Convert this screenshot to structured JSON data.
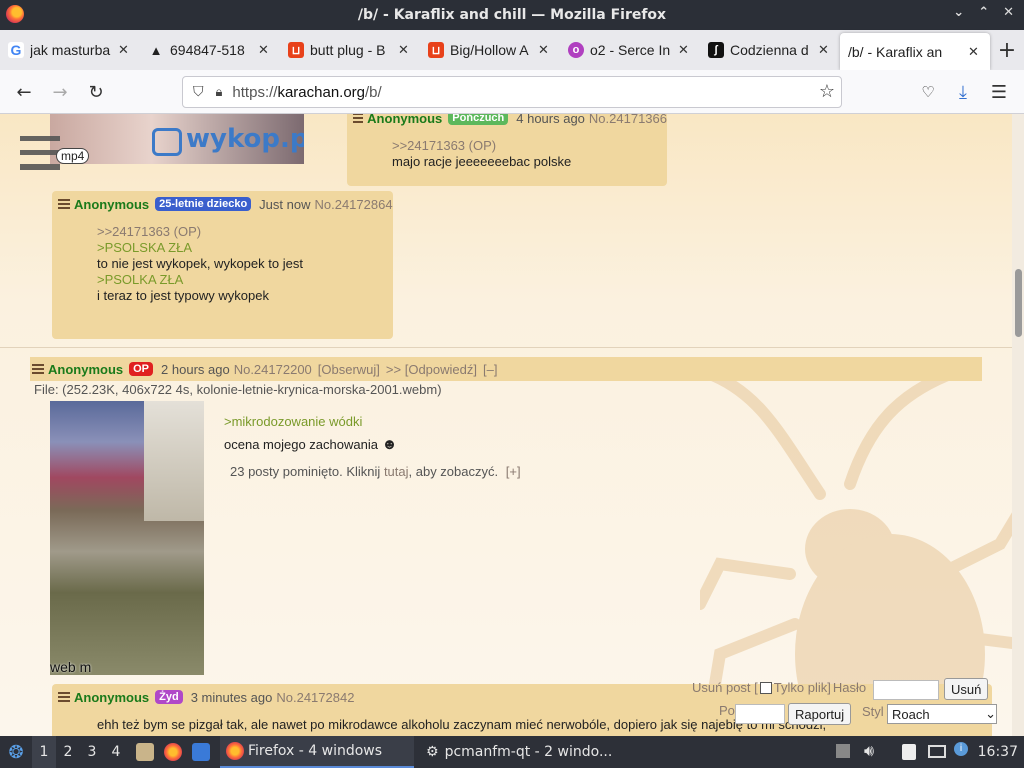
{
  "window": {
    "title": "/b/ - Karaflix and chill — Mozilla Firefox",
    "controls": [
      "⌄",
      "⌃",
      "✕"
    ]
  },
  "tabs": [
    {
      "title": "jak masturba",
      "icon": "google-icon",
      "color": "#4285f4",
      "glyph": "G"
    },
    {
      "title": "694847-518",
      "icon": "warning-icon",
      "color": "#222222",
      "glyph": "▲"
    },
    {
      "title": "butt plug - B",
      "icon": "shop-icon",
      "color": "#e8411a",
      "glyph": "⊔"
    },
    {
      "title": "Big/Hollow A",
      "icon": "shop-icon",
      "color": "#e8411a",
      "glyph": "⊔"
    },
    {
      "title": "o2 - Serce In",
      "icon": "o2-icon",
      "color": "#b040c0",
      "glyph": "o"
    },
    {
      "title": "Codzienna d",
      "icon": "book-icon",
      "color": "#111111",
      "glyph": "ʃ"
    },
    {
      "title": "/b/ - Karaflix an",
      "icon": "",
      "color": "#ffffff",
      "glyph": ""
    }
  ],
  "new_tab": "+",
  "nav": {
    "url_prefix": "https://",
    "url_domain": "karachan.org",
    "url_path": "/b/"
  },
  "page": {
    "vid1_logo": "wykop.pl",
    "vid1_label": "mp4",
    "reply1": {
      "name": "Anonymous",
      "badge": "Pończuch",
      "badge_color": "#5cb85c",
      "time": "4 hours ago",
      "no": "No.24171366",
      "lines": [
        {
          "cls": "qlink",
          "text": ">>24171363 (OP)"
        },
        {
          "cls": "plain",
          "text": "majo racje jeeeeeeebac polske"
        }
      ]
    },
    "reply2": {
      "name": "Anonymous",
      "badge": "25-letnie dziecko",
      "badge_color": "#3a5fcd",
      "time": "Just now",
      "no": "No.24172864",
      "lines": [
        {
          "cls": "qlink",
          "text": ">>24171363 (OP)"
        },
        {
          "cls": "green",
          "text": ">PSOLSKA ZŁA"
        },
        {
          "cls": "plain",
          "text": "to nie jest wykopek, wykopek to jest"
        },
        {
          "cls": "green",
          "text": ">PSOLKA ZŁA"
        },
        {
          "cls": "plain",
          "text": " "
        },
        {
          "cls": "plain",
          "text": "i teraz to jest typowy wykopek"
        }
      ]
    },
    "op": {
      "name": "Anonymous",
      "badge": "OP",
      "badge_color": "#e02020",
      "time": "2 hours ago",
      "no": "No.24172200",
      "watch": "[Obserwuj]",
      "reply": ">> [Odpowiedź]",
      "collapse": "[–]",
      "file": "File: (252.23K, 406x722 4s, kolonie-letnie-krynica-morska-2001.webm)",
      "thumb_label": "web m",
      "greentext": ">mikrodozowanie wódki",
      "text": "ocena mojego zachowania",
      "omitted_a": "23 posty pominięto. Kliknij",
      "omitted_link": "tutaj",
      "omitted_b": ", aby zobaczyć.",
      "omitted_expand": "[+]"
    },
    "reply3": {
      "name": "Anonymous",
      "badge": "Żyd",
      "badge_color": "#b048c8",
      "time": "3 minutes ago",
      "no": "No.24172842",
      "text": "ehh też bym se pizgał tak, ale nawet po mikrodawce alkoholu zaczynam mieć nerwobóle, dopiero jak się najebię to mi schodzi,"
    },
    "delete_form": {
      "delete_label": "Usuń post [",
      "only_file": "Tylko plik]",
      "password": "Hasło",
      "delete_btn": "Usuń",
      "reason": "Powód",
      "report_btn": "Raportuj",
      "style_label": "Styl",
      "style_value": "Roach"
    }
  },
  "taskbar": {
    "workspaces": [
      "1",
      "2",
      "3",
      "4"
    ],
    "tasks": [
      {
        "label": "Firefox - 4 windows",
        "active": true
      },
      {
        "label": "pcmanfm-qt - 2 windo...",
        "active": false
      }
    ],
    "clock": "16:37"
  }
}
